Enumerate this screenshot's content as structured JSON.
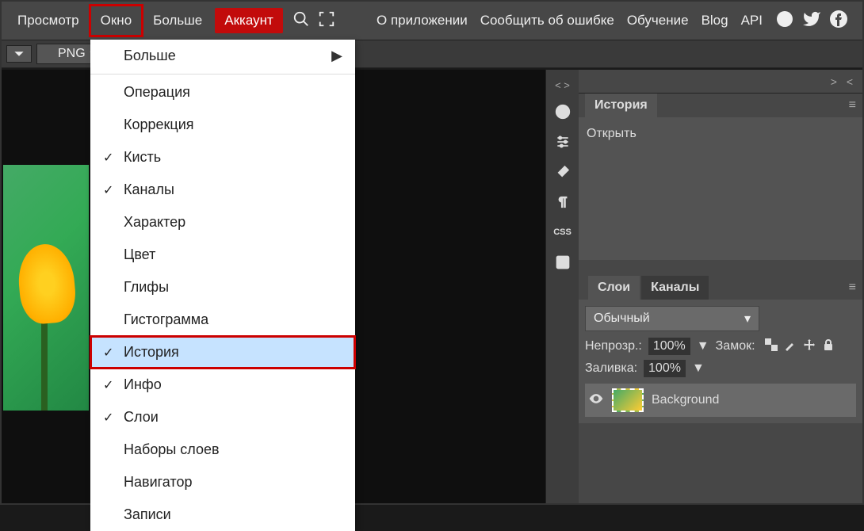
{
  "menubar": {
    "items": [
      "Просмотр",
      "Окно",
      "Больше",
      "Аккаунт"
    ],
    "right_links": [
      "О приложении",
      "Сообщить об ошибке",
      "Обучение",
      "Blog",
      "API"
    ]
  },
  "secondary": {
    "png_label": "PNG"
  },
  "dropdown": {
    "items": [
      {
        "label": "Больше",
        "checked": false,
        "submenu": true
      },
      {
        "label": "Операция",
        "checked": false
      },
      {
        "label": "Коррекция",
        "checked": false
      },
      {
        "label": "Кисть",
        "checked": true
      },
      {
        "label": "Каналы",
        "checked": true
      },
      {
        "label": "Характер",
        "checked": false
      },
      {
        "label": "Цвет",
        "checked": false
      },
      {
        "label": "Глифы",
        "checked": false
      },
      {
        "label": "Гистограмма",
        "checked": false
      },
      {
        "label": "История",
        "checked": true,
        "selected": true,
        "boxed": true
      },
      {
        "label": "Инфо",
        "checked": true
      },
      {
        "label": "Слои",
        "checked": true
      },
      {
        "label": "Наборы слоев",
        "checked": false
      },
      {
        "label": "Навигатор",
        "checked": false
      },
      {
        "label": "Записи",
        "checked": false
      }
    ]
  },
  "history_panel": {
    "title": "История",
    "entries": [
      "Открыть"
    ]
  },
  "layers_panel": {
    "tabs": [
      "Слои",
      "Каналы"
    ],
    "blend_mode": "Обычный",
    "opacity_label": "Непрозр.:",
    "opacity_value": "100%",
    "lock_label": "Замок:",
    "fill_label": "Заливка:",
    "fill_value": "100%",
    "layers": [
      {
        "name": "Background",
        "visible": true
      }
    ]
  },
  "toolstrip": {
    "head": "< >",
    "css_label": "CSS"
  },
  "expand_marker": "> <"
}
